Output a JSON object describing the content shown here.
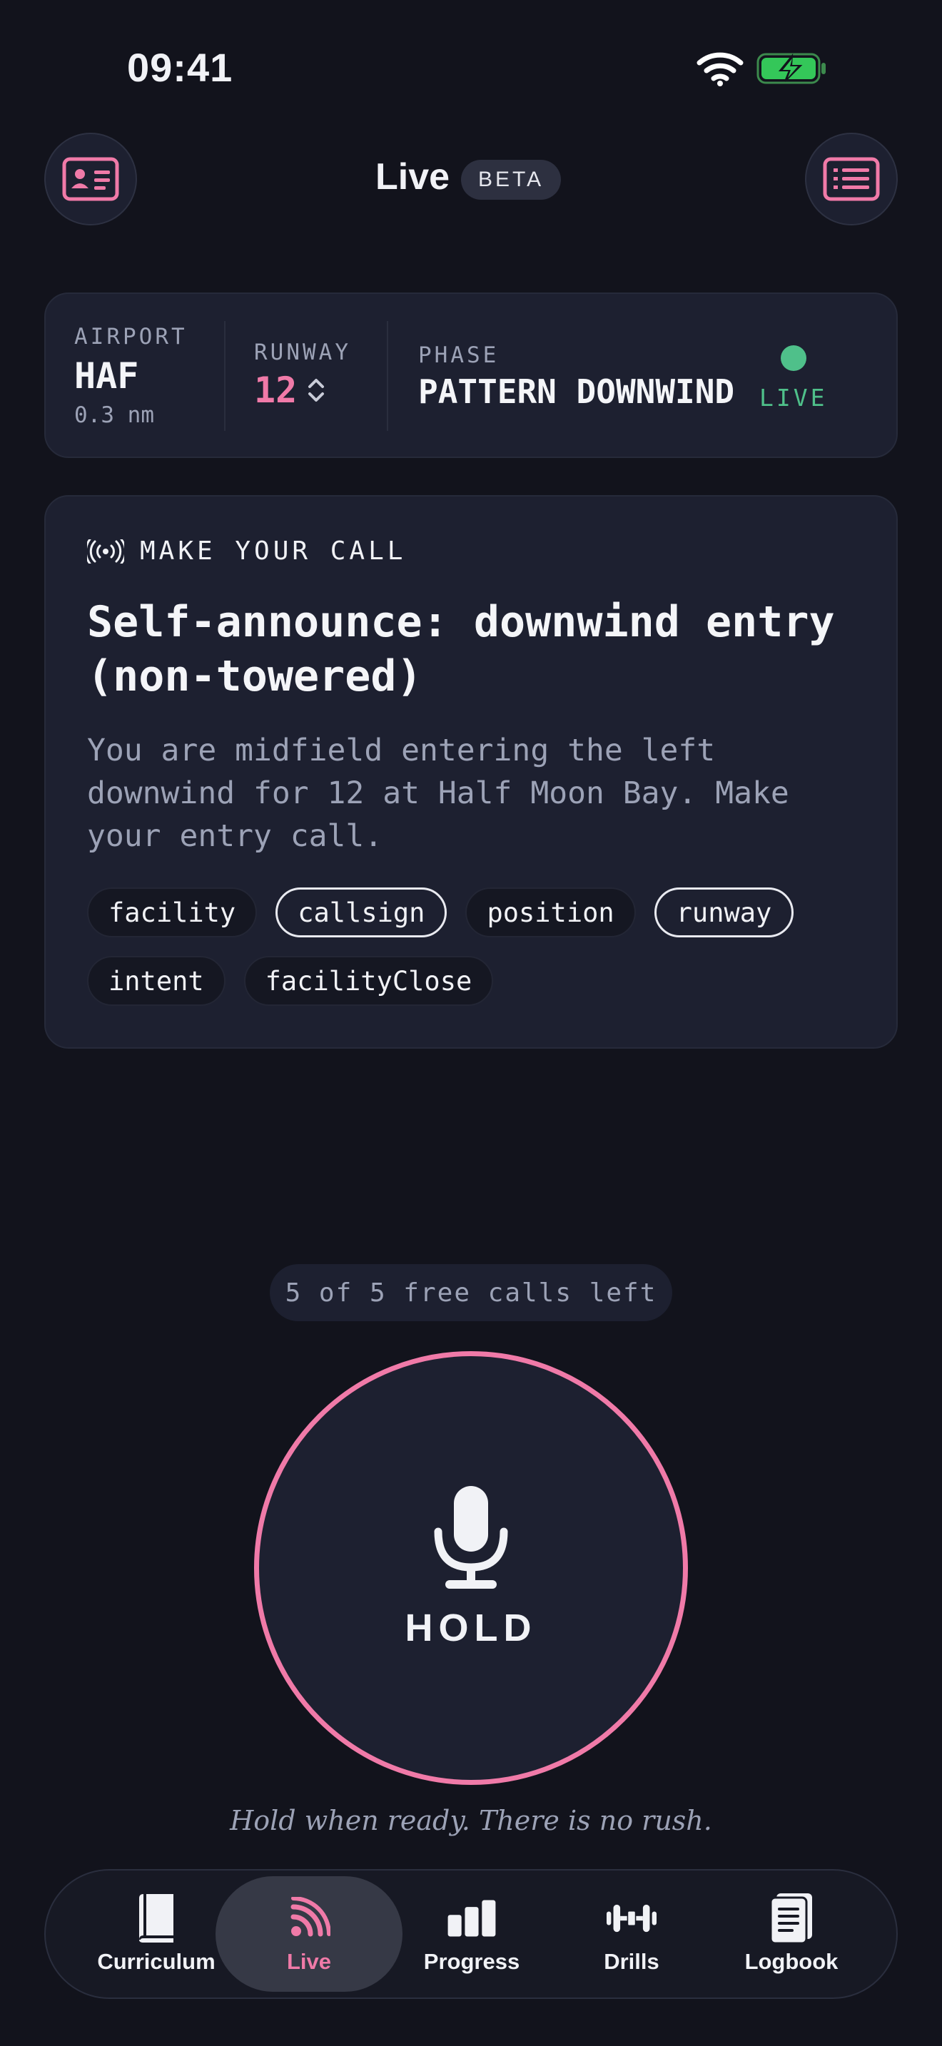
{
  "status_bar": {
    "time": "09:41",
    "wifi_icon": "wifi-icon",
    "battery_icon": "battery-charging-icon"
  },
  "header": {
    "title": "Live",
    "badge": "BETA",
    "left_button_icon": "id-card-icon",
    "right_button_icon": "list-card-icon"
  },
  "info": {
    "airport_label": "AIRPORT",
    "airport_value": "HAF",
    "airport_distance": "0.3 nm",
    "runway_label": "RUNWAY",
    "runway_value": "12",
    "phase_label": "PHASE",
    "phase_value": "PATTERN DOWNWIND",
    "live_label": "LIVE"
  },
  "call": {
    "header_label": "MAKE YOUR CALL",
    "title": "Self-announce: downwind entry (non-towered)",
    "description": "You are midfield entering the left downwind for 12 at Half Moon Bay. Make your entry call.",
    "chips": [
      {
        "label": "facility",
        "active": false
      },
      {
        "label": "callsign",
        "active": true
      },
      {
        "label": "position",
        "active": false
      },
      {
        "label": "runway",
        "active": true
      },
      {
        "label": "intent",
        "active": false
      },
      {
        "label": "facilityClose",
        "active": false
      }
    ]
  },
  "free_calls": "5 of 5 free calls left",
  "hold": {
    "label": "HOLD",
    "icon": "microphone-icon"
  },
  "hint": "Hold when ready. There is no rush.",
  "tabs": [
    {
      "label": "Curriculum",
      "icon": "book-icon",
      "active": false
    },
    {
      "label": "Live",
      "icon": "broadcast-icon",
      "active": true
    },
    {
      "label": "Progress",
      "icon": "bar-chart-icon",
      "active": false
    },
    {
      "label": "Drills",
      "icon": "dumbbell-icon",
      "active": false
    },
    {
      "label": "Logbook",
      "icon": "logbook-icon",
      "active": false
    }
  ],
  "colors": {
    "accent": "#f07aa8",
    "live": "#4fc08a",
    "background": "#12131c",
    "card": "#1d2030"
  }
}
